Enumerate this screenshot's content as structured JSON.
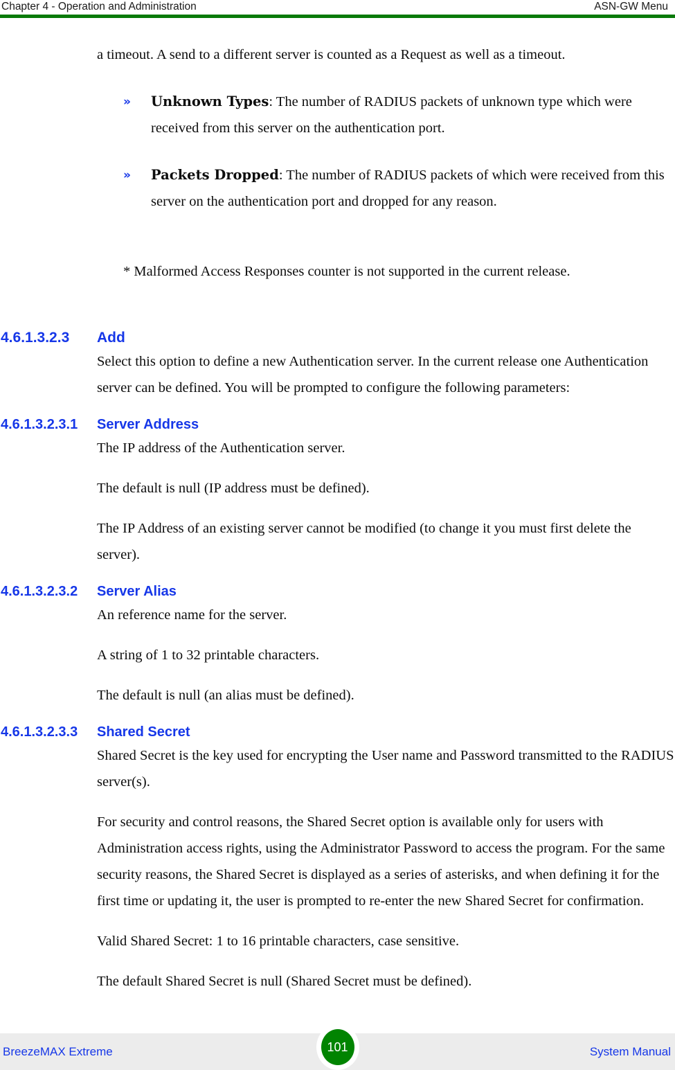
{
  "header": {
    "left": "Chapter 4 - Operation and Administration",
    "right": "ASN-GW Menu",
    "rule_color": "#0a7a0a"
  },
  "colors": {
    "heading_blue": "#1637e8",
    "bullet_blue": "#1637e8",
    "footer_band": "#ececec",
    "badge_green": "#018401",
    "body_text": "#0d0d0d"
  },
  "content": {
    "intro_paragraph": "a timeout. A send to a different server is counted as a Request as well as a timeout.",
    "bullets": [
      {
        "marker": "»",
        "term": "Unknown Types",
        "text": ": The number of RADIUS packets of unknown type which were received from this server on the authentication port."
      },
      {
        "marker": "»",
        "term": "Packets Dropped",
        "text": ": The number of RADIUS packets of which were received from this server on the authentication port and dropped for any reason."
      }
    ],
    "footnote": "* Malformed Access Responses counter is not supported in the current release.",
    "sections": [
      {
        "number": "4.6.1.3.2.3",
        "title": "Add",
        "paragraphs": [
          "Select this option to define a new Authentication server. In the current release one Authentication server can be defined. You will be prompted to configure the following parameters:"
        ]
      },
      {
        "number": "4.6.1.3.2.3.1",
        "title": "Server Address",
        "paragraphs": [
          "The IP address of the Authentication server.",
          "The default is null (IP address must be defined).",
          "The IP Address of an existing server cannot be modified (to change it you must first delete the server)."
        ]
      },
      {
        "number": "4.6.1.3.2.3.2",
        "title": "Server Alias",
        "paragraphs": [
          "An reference name for the server.",
          "A string of 1 to 32 printable characters.",
          "The default is null (an alias must be defined)."
        ]
      },
      {
        "number": "4.6.1.3.2.3.3",
        "title": "Shared Secret",
        "paragraphs": [
          "Shared Secret is the key used for encrypting the User name and Password transmitted to the RADIUS server(s).",
          "For security and control reasons, the Shared Secret option is available only for users with Administration access rights, using the Administrator Password to access the program. For the same security reasons, the Shared Secret is displayed as a series of asterisks, and when defining it for the first time or updating it, the user is prompted to re-enter the new Shared Secret for confirmation.",
          "Valid Shared Secret: 1 to 16 printable characters, case sensitive.",
          "The default Shared Secret is null (Shared Secret must be defined)."
        ]
      }
    ]
  },
  "footer": {
    "left": "BreezeMAX Extreme",
    "page_number": "101",
    "right": "System Manual"
  }
}
